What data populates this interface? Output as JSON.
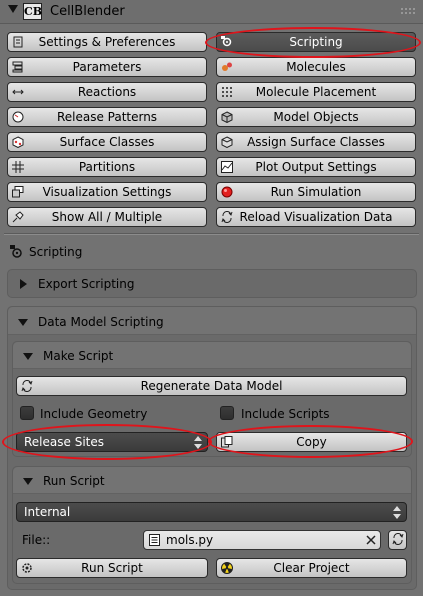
{
  "header": {
    "logo_text": "CB",
    "title": "CellBlender"
  },
  "menu_buttons": [
    {
      "label": "Settings & Preferences",
      "icon": "settings-doc-icon"
    },
    {
      "label": "Scripting",
      "icon": "scripting-gear-icon",
      "active": true
    },
    {
      "label": "Parameters",
      "icon": "parameters-icon"
    },
    {
      "label": "Molecules",
      "icon": "molecules-icon"
    },
    {
      "label": "Reactions",
      "icon": "reactions-arrow-icon"
    },
    {
      "label": "Molecule Placement",
      "icon": "placement-grid-icon"
    },
    {
      "label": "Release Patterns",
      "icon": "release-clock-icon"
    },
    {
      "label": "Model Objects",
      "icon": "model-object-cube-icon"
    },
    {
      "label": "Surface Classes",
      "icon": "surface-class-cube-icon"
    },
    {
      "label": "Assign Surface Classes",
      "icon": "assign-cube-icon"
    },
    {
      "label": "Partitions",
      "icon": "partitions-grid-icon"
    },
    {
      "label": "Plot Output Settings",
      "icon": "plot-icon"
    },
    {
      "label": "Visualization Settings",
      "icon": "visualization-icon"
    },
    {
      "label": "Run Simulation",
      "icon": "run-red-dot-icon"
    },
    {
      "label": "Show All / Multiple",
      "icon": "pin-icon"
    },
    {
      "label": "Reload Visualization Data",
      "icon": "reload-icon"
    }
  ],
  "scripting_section": {
    "title": "Scripting",
    "export_panel": {
      "label": "Export Scripting",
      "expanded": false
    },
    "data_model_panel": {
      "label": "Data Model Scripting",
      "expanded": true,
      "make_script": {
        "label": "Make Script",
        "regenerate_label": "Regenerate Data Model",
        "include_geometry_label": "Include Geometry",
        "include_scripts_label": "Include Scripts",
        "dropdown_value": "Release Sites",
        "copy_label": "Copy"
      },
      "run_script": {
        "label": "Run Script",
        "mode_value": "Internal",
        "file_label": "File::",
        "file_value": "mols.py",
        "run_label": "Run Script",
        "clear_label": "Clear Project"
      }
    }
  },
  "colors": {
    "annotation": "#e0141b",
    "active_button": "#555555",
    "panel": "#727272"
  }
}
